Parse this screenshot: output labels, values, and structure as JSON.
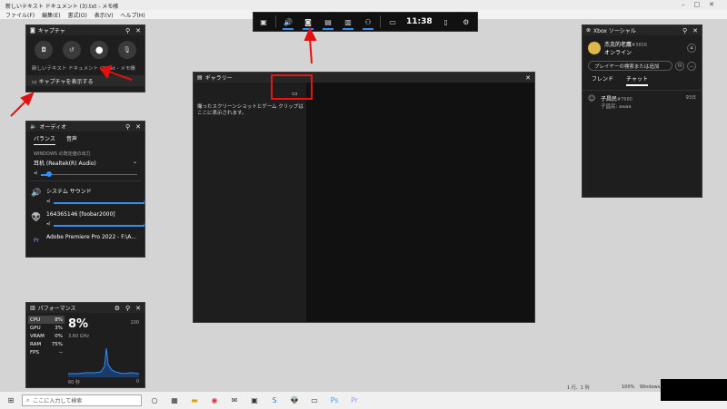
{
  "notepad": {
    "title": "新しいテキスト ドキュメント (3).txt - メモ帳",
    "menu": [
      "ファイル(F)",
      "編集(E)",
      "書式(O)",
      "表示(V)",
      "ヘルプ(H)"
    ],
    "status": {
      "pos": "1 行、1 列",
      "zoom": "100%",
      "eol": "Windows (CRLF)"
    }
  },
  "gamebar": {
    "time": "11:38"
  },
  "capture": {
    "title": "キャプチャ",
    "file": "新しいテキスト ドキュメント (3).txt - メモ帳",
    "show_label": "キャプチャを表示する"
  },
  "audio": {
    "title": "オーディオ",
    "tabs": [
      "バランス",
      "音声"
    ],
    "output_label": "WINDOWS の既定値の出力",
    "device": "耳机 (Realtek(R) Audio)",
    "apps": [
      {
        "name": "システム サウンド"
      },
      {
        "name": "164365146 [foobar2000]"
      },
      {
        "name": "Adobe Premiere Pro 2022 - F:\\A..."
      }
    ]
  },
  "performance": {
    "title": "パフォーマンス",
    "items": [
      {
        "label": "CPU",
        "value": "8%"
      },
      {
        "label": "GPU",
        "value": "3%"
      },
      {
        "label": "VRAM",
        "value": "0%"
      },
      {
        "label": "RAM",
        "value": "75%"
      },
      {
        "label": "FPS",
        "value": "--"
      }
    ],
    "big_value": "8%",
    "freq": "3.60 GHz",
    "max": "100",
    "min": "0",
    "duration": "60 秒"
  },
  "gallery": {
    "title": "ギャラリー",
    "empty_text": "撮ったスクリーンショットとゲーム クリップはここに表示されます。"
  },
  "social": {
    "title": "Xbox ソーシャル",
    "user": "杰克的老鷹",
    "user_tag": "#3858",
    "status": "オンライン",
    "search_placeholder": "プレイヤーの検索または追加",
    "tabs": [
      "フレンド",
      "チャット"
    ],
    "chat_name": "子昌民",
    "chat_tag": "#7680",
    "chat_sub": "子昌民: aaaa",
    "chat_time": "93日"
  },
  "taskbar": {
    "search_placeholder": "ここに入力して検索"
  },
  "colors": {
    "accent": "#2f8fff",
    "annotation": "#e11111"
  }
}
